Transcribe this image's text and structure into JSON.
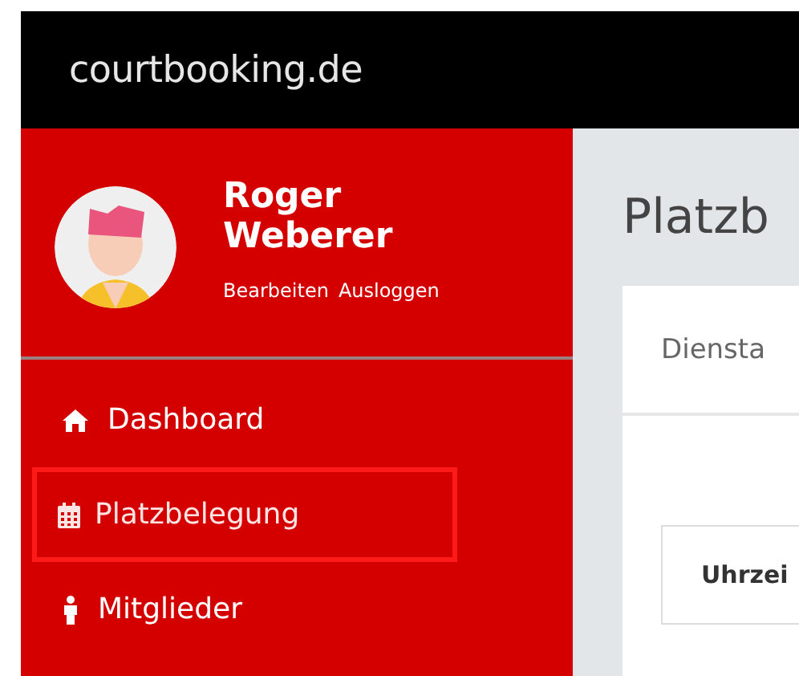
{
  "header": {
    "logo": "courtbooking.de"
  },
  "profile": {
    "name": "Roger Weberer",
    "links": [
      "Bearbeiten",
      "Ausloggen"
    ]
  },
  "nav": [
    {
      "label": "Dashboard",
      "selected": false
    },
    {
      "label": "Platzbelegung",
      "selected": true
    },
    {
      "label": "Mitglieder",
      "selected": false
    }
  ],
  "page_title": "Platzb",
  "card": {
    "day": "Diensta",
    "table": {
      "column_1": "Uhrzei"
    }
  }
}
